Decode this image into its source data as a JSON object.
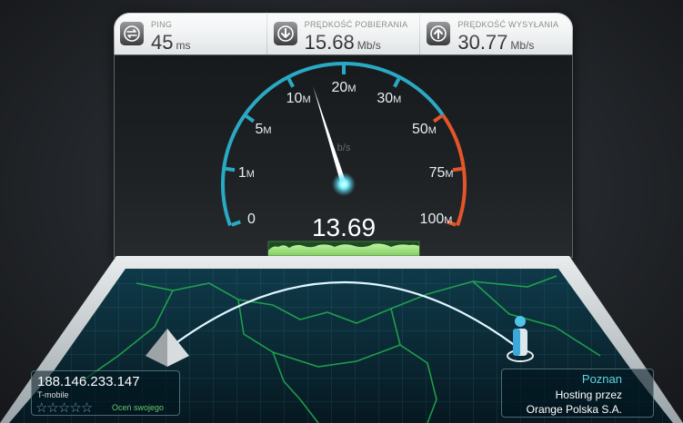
{
  "stats": {
    "ping": {
      "label": "PING",
      "value": "45",
      "unit": "ms",
      "icon": "ping-icon"
    },
    "download": {
      "label": "PRĘDKOŚĆ POBIERANIA",
      "value": "15.68",
      "unit": "Mb/s",
      "icon": "download-arrow-icon"
    },
    "upload": {
      "label": "PRĘDKOŚĆ WYSYŁANIA",
      "value": "30.77",
      "unit": "Mb/s",
      "icon": "upload-arrow-icon"
    }
  },
  "gauge": {
    "current_value": "13.69",
    "current_mbps": 13.69,
    "unit_label": "b/s",
    "ticks": [
      {
        "label": "0",
        "suffix": ""
      },
      {
        "label": "1",
        "suffix": "M"
      },
      {
        "label": "5",
        "suffix": "M"
      },
      {
        "label": "10",
        "suffix": "M"
      },
      {
        "label": "20",
        "suffix": "M"
      },
      {
        "label": "30",
        "suffix": "M"
      },
      {
        "label": "50",
        "suffix": "M"
      },
      {
        "label": "75",
        "suffix": "M"
      },
      {
        "label": "100",
        "suffix": "M"
      }
    ],
    "colors": {
      "arc_blue": "#2aa9c4",
      "arc_red": "#e5542a",
      "needle": "#ffffff",
      "glow": "#7ff3ff"
    }
  },
  "client": {
    "ip": "188.146.233.147",
    "isp": "T-mobile",
    "rating_stars": "☆☆☆☆☆",
    "rate_label": "Oceń swojego"
  },
  "server": {
    "city": "Poznan",
    "hosting_line1": "Hosting przez",
    "hosting_line2": "Orange Polska S.A."
  }
}
